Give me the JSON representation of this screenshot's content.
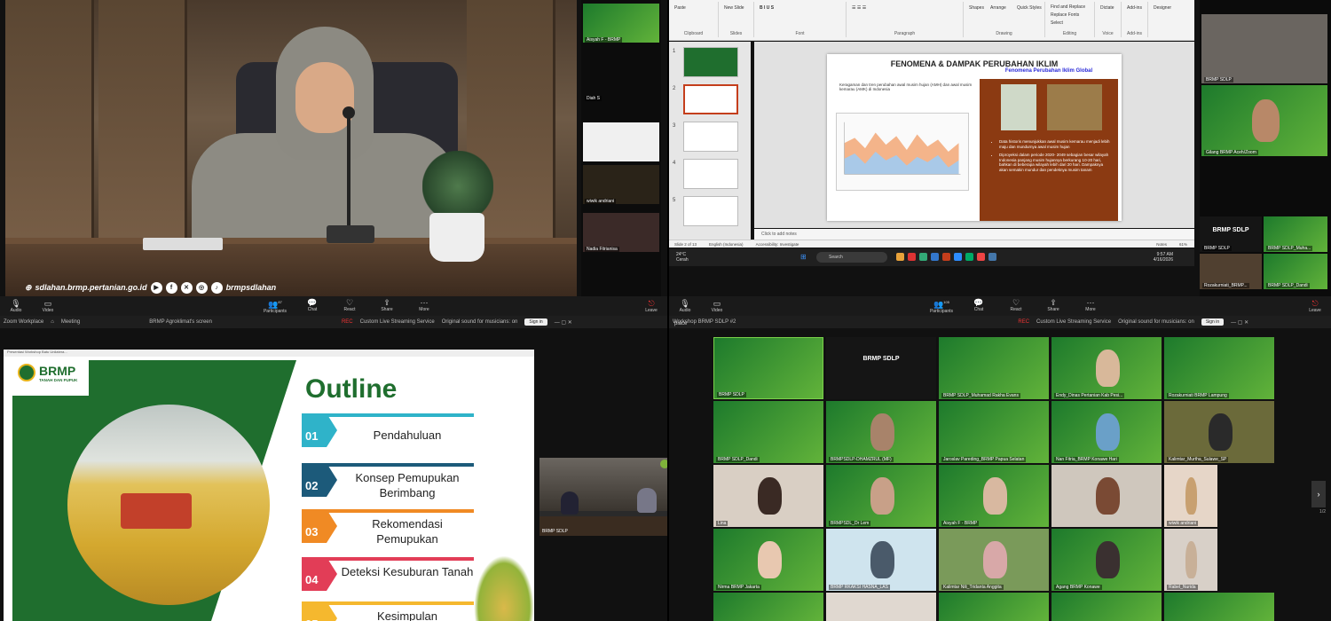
{
  "colors": {
    "brmp_green": "#1f6e2e",
    "zoom_bar": "#1a1a1a",
    "leave_red": "#e33333",
    "ppt_accent": "#c43e1c"
  },
  "toolbar": {
    "audio": "Audio",
    "video": "Video",
    "participants": "Participants",
    "participants_count_1": "87",
    "participants_count_2": "105",
    "chat": "Chat",
    "react": "React",
    "share": "Share",
    "more": "More",
    "leave": "Leave"
  },
  "q1": {
    "social_handle_left": "sdlahan.brmp.pertanian.go.id",
    "social_handle_right": "brmpsdlahan",
    "strip": [
      "Aisyah F - BRMP",
      "Diah S",
      "",
      "wiwik andriani",
      "Nadia Fitrianisa"
    ]
  },
  "q2": {
    "ribbon": {
      "clipboard": "Clipboard",
      "slides": "Slides",
      "font": "Font",
      "paragraph": "Paragraph",
      "drawing": "Drawing",
      "editing": "Editing",
      "voice": "Voice",
      "addins": "Add-ins",
      "paste": "Paste",
      "new_slide": "New Slide",
      "shapes": "Shapes",
      "arrange": "Arrange",
      "quick_styles": "Quick Styles",
      "find_replace": "Find and Replace",
      "replace_fonts": "Replace Fonts",
      "select": "Select",
      "dictate": "Dictate",
      "addins_btn": "Add-ins",
      "designer": "Designer"
    },
    "slide": {
      "title": "FENOMENA & DAMPAK PERUBAHAN IKLIM",
      "subtitle": "Keragaman dan tren perubahan awal musim hujan (AMH) dan awal musim kemarau (AMK) di Indonesia",
      "right_header": "Fenomena Perubahan Iklim Global",
      "bullets": [
        "Data historis menunjukkan awal musim kemarau menjadi lebih maju dan mundurnya awal musim hujan",
        "Diproyeksi dalam periode 2020- 2049 sebagian besar wilayah Indonesia panjang musim hujannya berkurang 10-20 hari, bahkan di beberapa wilayah lebih dari 20 hari. Dampaknya akan semakin mundur dan pendeknya musim tanam"
      ]
    },
    "notes": "Click to add notes",
    "status": {
      "slide": "Slide 2 of 13",
      "language": "English (Indonesia)",
      "accessibility": "Accessibility: Investigate",
      "notes_btn": "Notes",
      "zoom": "61%"
    },
    "taskbar": {
      "weather_temp": "24°C",
      "weather_desc": "Cerah",
      "search": "Search",
      "time": "9:57 AM",
      "date": "4/16/2026"
    },
    "gallery": {
      "top_name": "",
      "big_label": "BRMP SDLP",
      "n1": "BRMP SDLP",
      "n2": "BRMP SDLP_Muha...",
      "n3": "Rozakurniati_BRMP...",
      "n4": "BRMP SDLP_Dandi"
    },
    "side_name_1": "BRMP SDLP",
    "side_name_2": "Gilang BRMP Aceh/Zoom"
  },
  "q3": {
    "top_app": "Zoom Workplace",
    "tab_meeting": "Meeting",
    "tab_title": "BRMP Agroklimat's screen",
    "rec": "REC",
    "live": "Custom Live Streaming Service",
    "sound": "Original sound for musicians: on",
    "sign_in": "Sign in",
    "window_title": "Presentasi Workshop Batu Unilatera...",
    "logo_main": "BRMP",
    "logo_sub": "TANAH DAN PUPUK",
    "outline_title": "Outline",
    "items": [
      {
        "num": "01",
        "label": "Pendahuluan",
        "color": "#2fb3c9"
      },
      {
        "num": "02",
        "label": "Konsep Pemupukan Berimbang",
        "color": "#1c5a7a"
      },
      {
        "num": "03",
        "label": "Rekomendasi Pemupukan",
        "color": "#f08a24"
      },
      {
        "num": "04",
        "label": "Deteksi Kesuburan Tanah",
        "color": "#e23d57"
      },
      {
        "num": "05",
        "label": "Kesimpulan",
        "color": "#f5b82e"
      }
    ],
    "mini_name": "BRMP SDLP"
  },
  "q4": {
    "window_title": "Workshop BRMP SDLP #2",
    "place": "place",
    "rec": "REC",
    "live": "Custom Live Streaming Service",
    "sound": "Original sound for musicians: on",
    "sign_in": "Sign in",
    "big_label": "BRMP SDLP",
    "names": [
      "BRMP SDLP",
      "",
      "BRMP SDLP_Muhamad Rakha Evans",
      "Endy_Dinas Pertanian Kab Pesi...",
      "Rozakurniati BRMP Lampung",
      "BRMP SDLP_Dandi",
      "BRMPSDLP-DHAMZRUL (MF)",
      "Jaroslav Pareding_BRMP Papua Selatan",
      "Nan Fitria_BRMP Konawe Hari",
      "Kalimtar_Murtha_Sulawe_SP",
      "Lina",
      "BRMPSDL_Dr Lem",
      "Aisyah F - BRMP",
      "",
      "wiwik andriani",
      "Nirma BRMP Jakarta",
      "BRMP RKAKSI HASNA_LAS",
      "Kalimtar Nili_Tridanta Anggita",
      "Agang BRMP Konawe",
      "Rabel_Nurida",
      "",
      "",
      "",
      "",
      ""
    ],
    "page": "1/2"
  }
}
